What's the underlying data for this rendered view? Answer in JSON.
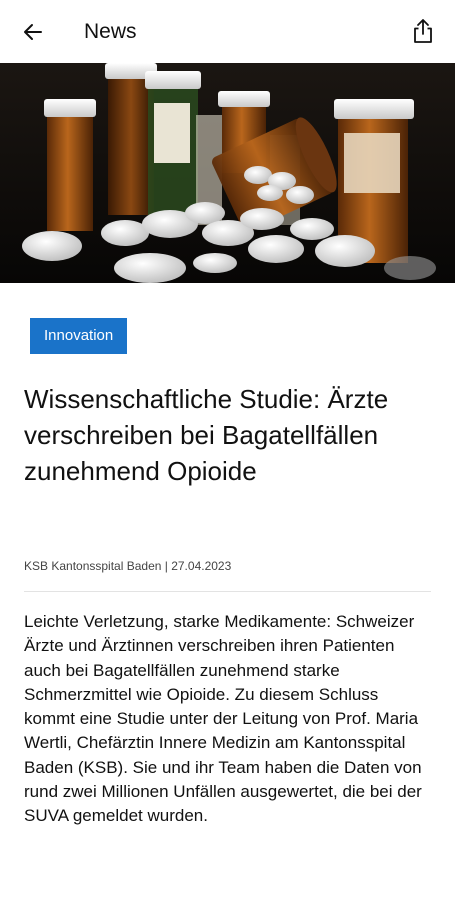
{
  "appbar": {
    "title": "News",
    "back_icon": "arrow-left-icon",
    "share_icon": "share-icon"
  },
  "hero": {
    "icon": "pills-photo"
  },
  "article": {
    "category": "Innovation",
    "title": "Wissenschaftliche Studie: Ärzte verschreiben bei Bagatellfällen zunehmend Opioide",
    "meta": "KSB Kantonsspital Baden | 27.04.2023",
    "body": "Leichte Verletzung, starke Medikamente: Schweizer Ärzte und Ärztinnen verschreiben ihren Patienten auch bei Bagatellfällen zunehmend starke Schmerzmittel wie Opioide. Zu diesem Schluss kommt eine Studie unter der Leitung von Prof. Maria Wertli, Chefärztin Innere Medizin am Kantonsspital Baden (KSB). Sie und ihr Team haben die Daten von rund zwei Millionen Unfällen ausgewertet, die bei der SUVA gemeldet wurden."
  },
  "colors": {
    "accent": "#1a73c9",
    "background": "#ffffff",
    "text": "#111111"
  }
}
